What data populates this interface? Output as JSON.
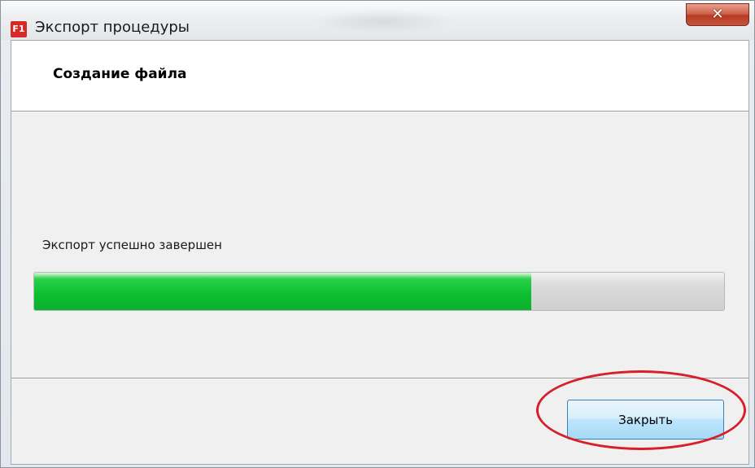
{
  "window": {
    "app_icon_text": "F1",
    "title": "Экспорт процедуры",
    "close_icon": "close-icon"
  },
  "header": {
    "title": "Создание файла"
  },
  "main": {
    "status_text": "Экспорт успешно завершен",
    "progress": {
      "value_fraction": 0.72,
      "color": "#0fbf33"
    }
  },
  "footer": {
    "close_button_label": "Закрыть"
  },
  "annotation": {
    "color": "#d81e28"
  }
}
